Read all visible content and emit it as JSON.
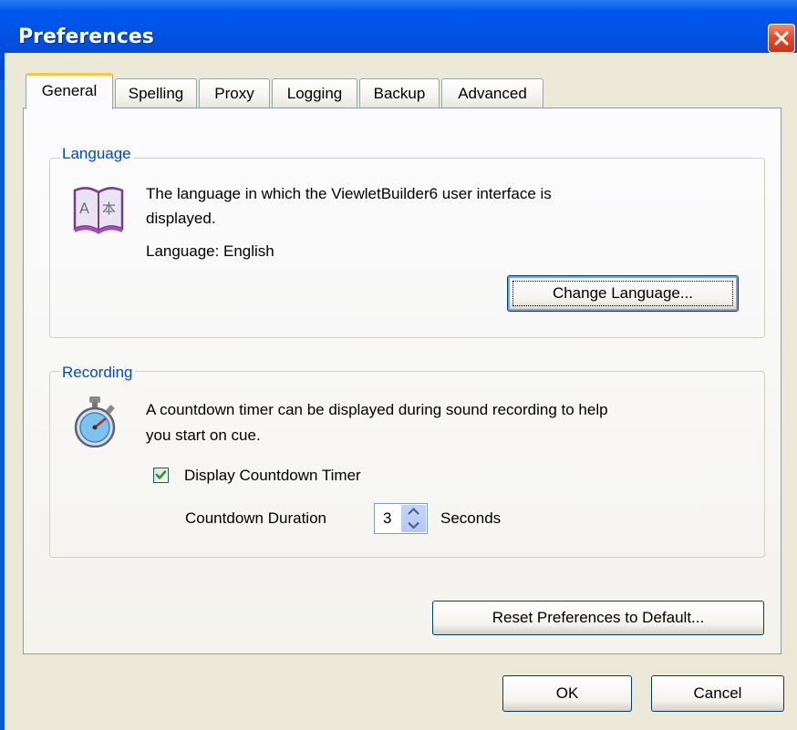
{
  "window": {
    "title": "Preferences",
    "close_icon": "close-x-icon"
  },
  "tabs": [
    {
      "label": "General",
      "active": true
    },
    {
      "label": "Spelling",
      "active": false
    },
    {
      "label": "Proxy",
      "active": false
    },
    {
      "label": "Logging",
      "active": false
    },
    {
      "label": "Backup",
      "active": false
    },
    {
      "label": "Advanced",
      "active": false
    }
  ],
  "language_group": {
    "title": "Language",
    "icon": "dictionary-book-icon",
    "description_line1": "The language in which the ViewletBuilder6 user interface is",
    "description_line2": "displayed.",
    "language_label": "Language:",
    "language_value": "English",
    "change_button": "Change Language..."
  },
  "recording_group": {
    "title": "Recording",
    "icon": "stopwatch-icon",
    "description_line1": "A countdown timer can be displayed during sound recording to help",
    "description_line2": "you start on cue.",
    "checkbox_label": "Display Countdown Timer",
    "checkbox_checked": true,
    "duration_label": "Countdown Duration",
    "duration_value": "3",
    "duration_unit": "Seconds"
  },
  "reset_button": "Reset Preferences to Default...",
  "footer": {
    "ok_button": "OK",
    "cancel_button": "Cancel"
  },
  "colors": {
    "titlebar": "#0058ee",
    "group_title": "#0046d5",
    "dialog_face": "#ece9d8",
    "active_tab_highlight": "#ffc83c",
    "checkmark": "#21a121"
  }
}
